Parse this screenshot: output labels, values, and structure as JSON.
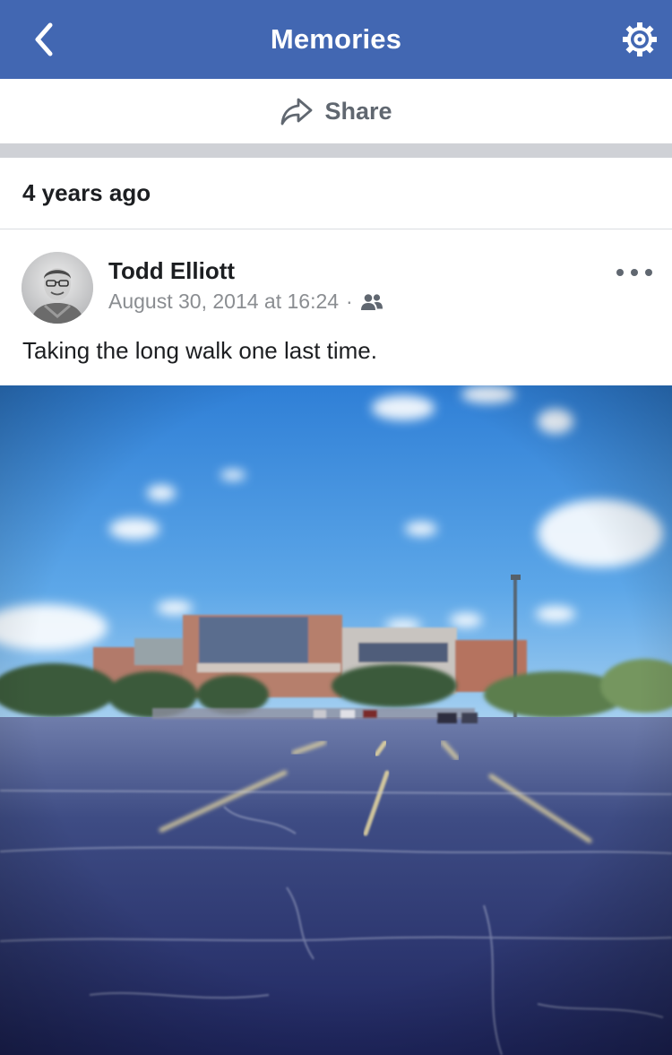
{
  "navbar": {
    "title": "Memories",
    "back_icon": "chevron-left-icon",
    "settings_icon": "gear-icon",
    "background": "#4267b2"
  },
  "share": {
    "label": "Share",
    "icon": "share-arrow-icon"
  },
  "section": {
    "title": "4 years ago"
  },
  "post": {
    "author": "Todd Elliott",
    "timestamp": "August 30, 2014 at 16:24",
    "separator": "·",
    "audience_icon": "friends-icon",
    "text": "Taking the long walk one last time.",
    "more_icon": "more-options-icon"
  }
}
